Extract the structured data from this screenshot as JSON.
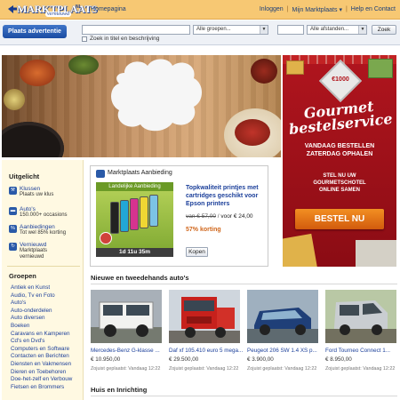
{
  "brand": {
    "logo_text": "MARKTPLAATS",
    "logo_sub": "vernieuwd",
    "logo_country": "NL"
  },
  "topnav": {
    "home": "Homepagina",
    "login": "Inloggen",
    "my": "Mijn Marktplaats",
    "my_arrow": "▾",
    "help": "Help en Contact",
    "separator": "|"
  },
  "search": {
    "place_ad": "Plaats advertentie",
    "query_value": "",
    "groups_select": "Alle groepen...",
    "postcode_value": "",
    "distance_select": "Alle afstanden...",
    "submit": "Zoek",
    "checkbox_label": "Zoek in titel en beschrijving"
  },
  "hero_ad": {
    "badge": "€1000",
    "title": "Gourmet bestelservice",
    "line1": "VANDAAG BESTELLEN",
    "line2": "ZATERDAG OPHALEN",
    "line3": "STEL NU UW",
    "line4": "GOURMETSCHOTEL",
    "line5": "ONLINE SAMEN",
    "cta": "BESTEL NU"
  },
  "sidebar": {
    "uitgelicht": "Uitgelicht",
    "items": [
      {
        "label": "Klussen",
        "sub": "Plaats uw klus",
        "icon": "hammer-icon"
      },
      {
        "label": "Auto's",
        "sub": "150.000+ occasions",
        "icon": "car-icon"
      },
      {
        "label": "Aanbiedingen",
        "sub": "Tot wel 85% korting",
        "icon": "discount-icon"
      },
      {
        "label": "Vernieuwd",
        "sub": "Marktplaats vernieuwd",
        "icon": "refresh-icon"
      }
    ],
    "groups_title": "Groepen",
    "groups": [
      "Antiek en Kunst",
      "Audio, Tv en Foto",
      "Auto's",
      "Auto-onderdelen",
      "Auto diversen",
      "Boeken",
      "Caravans en Kamperen",
      "Cd's en Dvd's",
      "Computers en Software",
      "Contacten en Berichten",
      "Diensten en Vakmensen",
      "Dieren en Toebehoren",
      "Doe-het-zelf en Verbouw",
      "Fietsen en Brommers"
    ]
  },
  "offer": {
    "header": "Marktplaats Aanbieding",
    "image_label": "Landelijke Aanbieding",
    "timer": "1d 11u 35m",
    "title": "Topkwaliteit printjes met cartridges geschikt voor Epson printers",
    "old_price": "van € 57,00",
    "new_price": "voor € 24,00",
    "discount": "57% korting",
    "buy": "Kopen"
  },
  "cars_section": {
    "title": "Nieuwe en tweedehands auto's",
    "cars": [
      {
        "title": "Mercedes-Benz G-klasse ...",
        "price": "€ 10.950,00",
        "date": "Zojuist geplaatst: Vandaag 12:22"
      },
      {
        "title": "Daf xf 105.410 euro 5 mega...",
        "price": "€ 29.500,00",
        "date": "Zojuist geplaatst: Vandaag 12:22"
      },
      {
        "title": "Peugeot 206 SW 1.4 XS p...",
        "price": "€ 3.900,00",
        "date": "Zojuist geplaatst: Vandaag 12:22"
      },
      {
        "title": "Ford Tourneo Connect 1...",
        "price": "€ 8.950,00",
        "date": "Zojuist geplaatst: Vandaag 12:22"
      }
    ]
  },
  "house_section": {
    "title": "Huis en Inrichting"
  }
}
